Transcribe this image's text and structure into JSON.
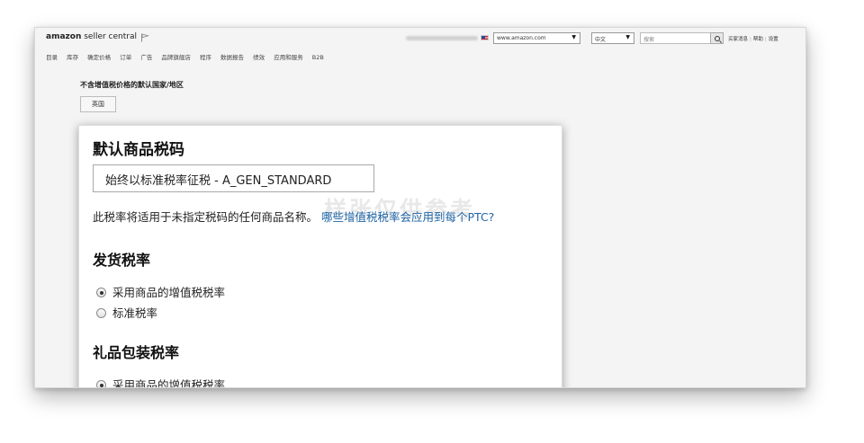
{
  "header": {
    "logo_bold": "amazon",
    "logo_rest": " seller central",
    "marketplace": "www.amazon.com",
    "language": "中文",
    "search_placeholder": "搜索",
    "links": [
      "买家消息",
      "帮助",
      "设置"
    ]
  },
  "nav": [
    "目录",
    "库存",
    "确定价格",
    "订单",
    "广告",
    "品牌旗舰店",
    "程序",
    "数据报告",
    "绩效",
    "应用和服务",
    "B2B"
  ],
  "section": {
    "label": "不含增值税价格的默认国家/地区",
    "country": "英国"
  },
  "card": {
    "title": "默认商品税码",
    "tax_code": "始终以标准税率征税 - A_GEN_STANDARD",
    "description": "此税率将适用于未指定税码的任何商品名称。",
    "link": "哪些增值税税率会应用到每个PTC?",
    "watermark": "样张仅供参考",
    "shipping": {
      "title": "发货税率",
      "options": [
        "采用商品的增值税税率",
        "标准税率"
      ],
      "selected": 0
    },
    "giftwrap": {
      "title": "礼品包装税率",
      "options": [
        "采用商品的增值税税率"
      ],
      "selected": 0
    }
  }
}
